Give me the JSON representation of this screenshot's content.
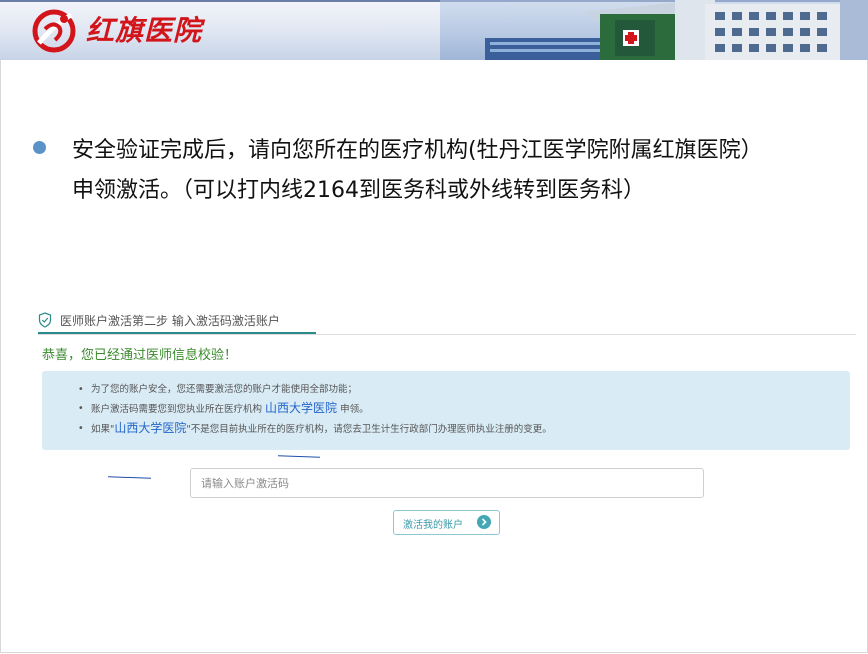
{
  "header": {
    "logo_text": "红旗医院",
    "brand_color": "#d2151b"
  },
  "slide": {
    "bullet_line1": "安全验证完成后，请向您所在的医疗机构(牡丹江医学院附属红旗医院）",
    "bullet_line2": "申领激活。（可以打内线2164到医务科或外线转到医务科）",
    "bullet_color": "#5b93c9"
  },
  "activation_page": {
    "step_title": "医师账户激活第二步 输入激活码激活账户",
    "congrats": "恭喜，您已经通过医师信息校验！",
    "info": {
      "item1": "为了您的账户安全，您还需要激活您的账户才能使用全部功能；",
      "item2_prefix": "账户激活码需要您到您执业所在医疗机构",
      "item2_hospital": "山西大学医院",
      "item2_suffix": "申领。",
      "item3_prefix": "如果\"",
      "item3_hospital": "山西大学医院",
      "item3_suffix": "\"不是您目前执业所在的医疗机构，请您去卫生计生行政部门办理医师执业注册的变更。"
    },
    "input_placeholder": "请输入账户激活码",
    "input_value": "",
    "activate_button": "激活我的账户",
    "accent_color": "#2b8a8a",
    "success_color": "#3a8a2c",
    "link_color": "#2465c9"
  }
}
